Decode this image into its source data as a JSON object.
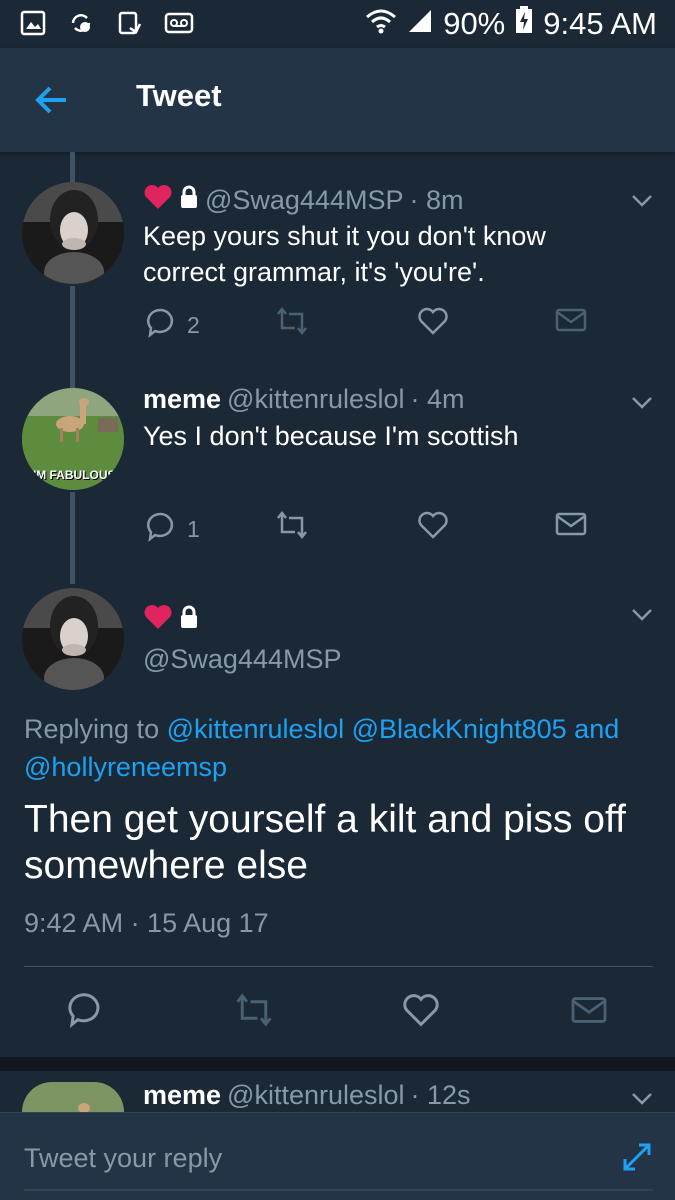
{
  "status_bar": {
    "battery": "90%",
    "time": "9:45 AM",
    "left_icons": [
      "gallery-icon",
      "sync-icon",
      "download-icon",
      "voicemail-icon"
    ],
    "right_icons": [
      "wifi-icon",
      "signal-icon",
      "battery-charging-icon"
    ]
  },
  "header": {
    "title": "Tweet",
    "back_icon": "back-arrow-icon"
  },
  "thread": [
    {
      "display_name": "",
      "handle": "@Swag444MSP",
      "time": "· 8m",
      "text": "Keep yours shut it you don't know correct grammar, it's 'you're'.",
      "reply_count": "2",
      "retweet_count": "",
      "badges": [
        "heart-emoji-icon",
        "lock-icon"
      ]
    },
    {
      "display_name": "meme",
      "handle": "@kittenruleslol",
      "time": "· 4m",
      "text": "Yes I don't because I'm scottish",
      "reply_count": "1",
      "avatar_caption": "I'M FABULOUS"
    }
  ],
  "main_tweet": {
    "handle": "@Swag444MSP",
    "badges": [
      "heart-emoji-icon",
      "lock-icon"
    ],
    "replying_to_label": "Replying to",
    "replying_to": [
      "@kittenruleslol",
      "@BlackKnight805"
    ],
    "replying_and": "and",
    "replying_last": "@hollyreneemsp",
    "text": "Then get yourself a kilt and piss off somewhere else",
    "timestamp": "9:42 AM · 15 Aug 17"
  },
  "next_reply": {
    "display_name": "meme",
    "handle": "@kittenruleslol",
    "time": "· 12s"
  },
  "composer": {
    "placeholder": "Tweet your reply",
    "expand_icon": "expand-icon"
  },
  "colors": {
    "background": "#1b2836",
    "header": "#243447",
    "accent": "#1da1f2",
    "muted": "#8899a6",
    "heart": "#e0245e"
  }
}
